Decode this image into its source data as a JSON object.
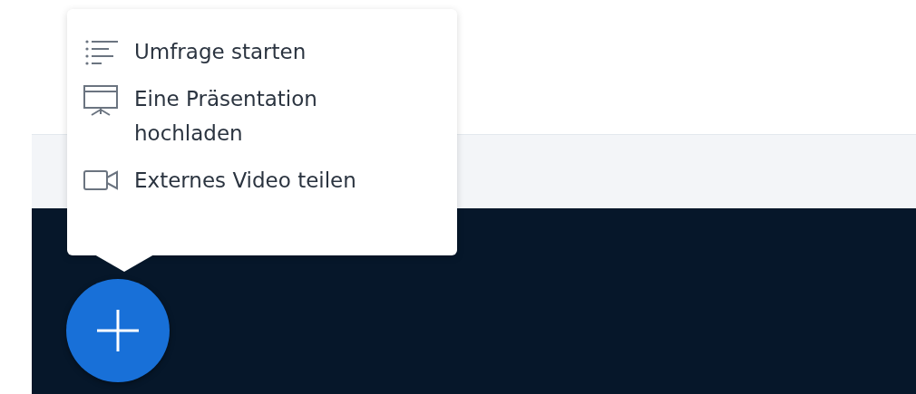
{
  "action_menu": {
    "items": [
      {
        "label": "Umfrage starten"
      },
      {
        "label": "Eine Präsentation hochladen"
      },
      {
        "label": "Externes Video teilen"
      }
    ]
  }
}
